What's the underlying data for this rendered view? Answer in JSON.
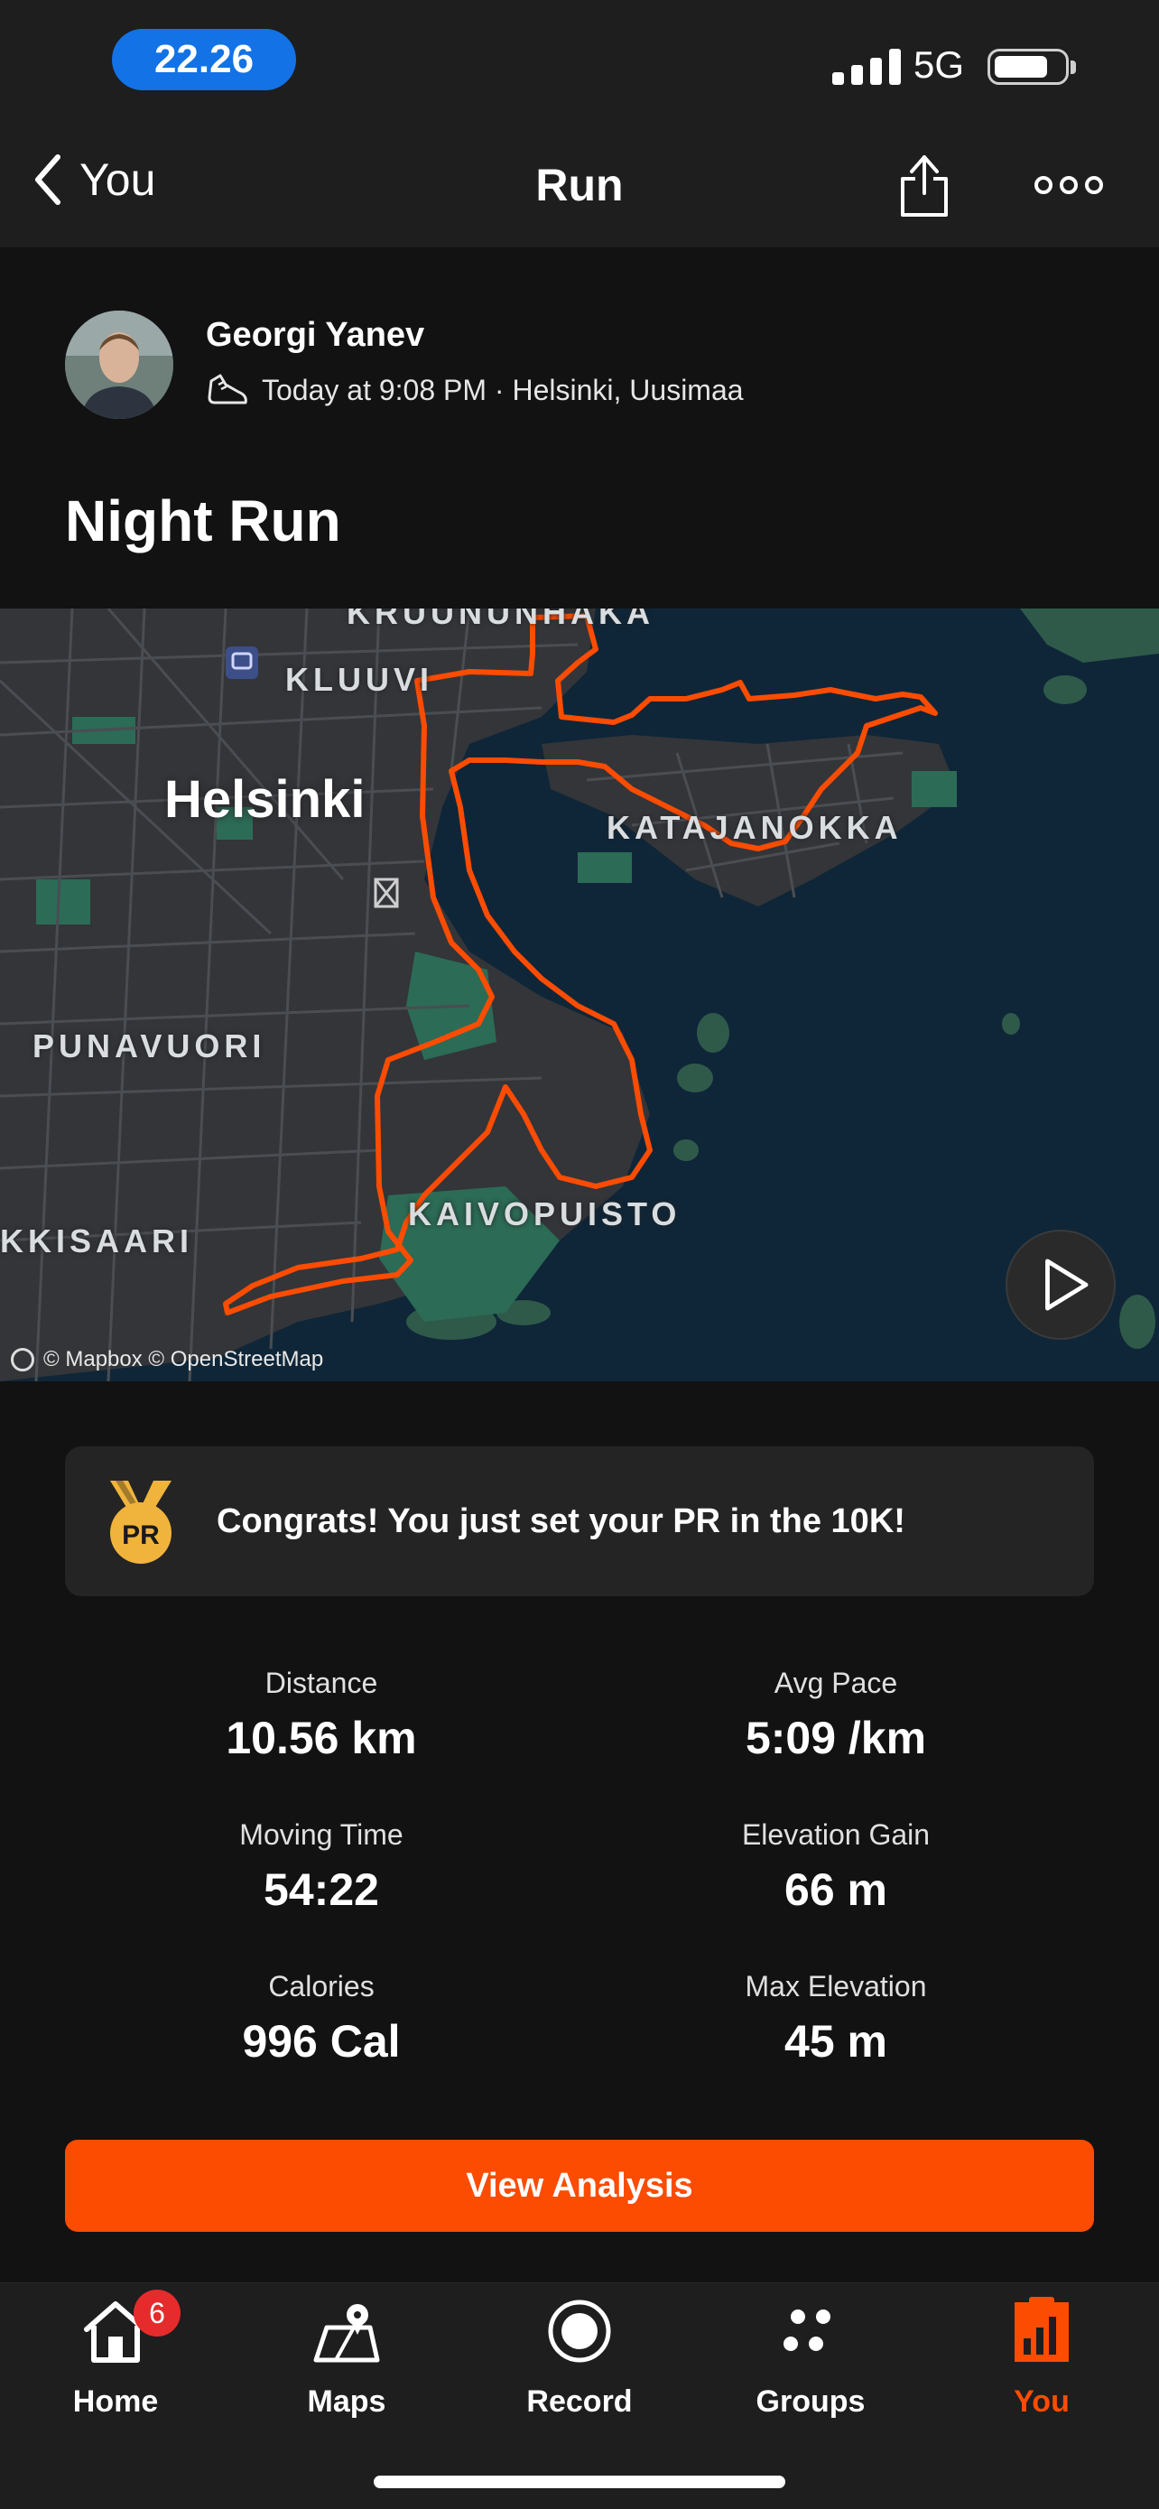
{
  "status_bar": {
    "time": "22.26",
    "network": "5G"
  },
  "nav": {
    "back_label": "You",
    "title": "Run"
  },
  "activity": {
    "athlete_name": "Georgi Yanev",
    "timestamp_location": "Today at 9:08 PM · Helsinki, Uusimaa",
    "title": "Night Run"
  },
  "map": {
    "city": "Helsinki",
    "labels": {
      "kruununhaka": "KRUUNUNHAKA",
      "kluuvi": "KLUUVI",
      "katajanokka": "KATAJANOKKA",
      "punavuori": "PUNAVUORI",
      "kaivopuisto": "KAIVOPUISTO",
      "ruoholahti": "KKISAARI"
    },
    "attribution": "© Mapbox © OpenStreetMap",
    "route_color": "#fc4c02"
  },
  "pr_banner": {
    "badge": "PR",
    "text": "Congrats! You just set your PR in the 10K!"
  },
  "stats": [
    {
      "label": "Distance",
      "value": "10.56 km"
    },
    {
      "label": "Avg Pace",
      "value": "5:09 /km"
    },
    {
      "label": "Moving Time",
      "value": "54:22"
    },
    {
      "label": "Elevation Gain",
      "value": "66 m"
    },
    {
      "label": "Calories",
      "value": "996 Cal"
    },
    {
      "label": "Max Elevation",
      "value": "45 m"
    }
  ],
  "cta_label": "View Analysis",
  "tabs": [
    {
      "label": "Home",
      "icon": "home-icon",
      "badge": "6"
    },
    {
      "label": "Maps",
      "icon": "maps-icon"
    },
    {
      "label": "Record",
      "icon": "record-icon"
    },
    {
      "label": "Groups",
      "icon": "groups-icon"
    },
    {
      "label": "You",
      "icon": "you-icon",
      "active": true
    }
  ],
  "colors": {
    "accent": "#fc4c02",
    "time_pill": "#1272e6",
    "badge": "#e52b2b",
    "medal": "#f0b43c"
  }
}
